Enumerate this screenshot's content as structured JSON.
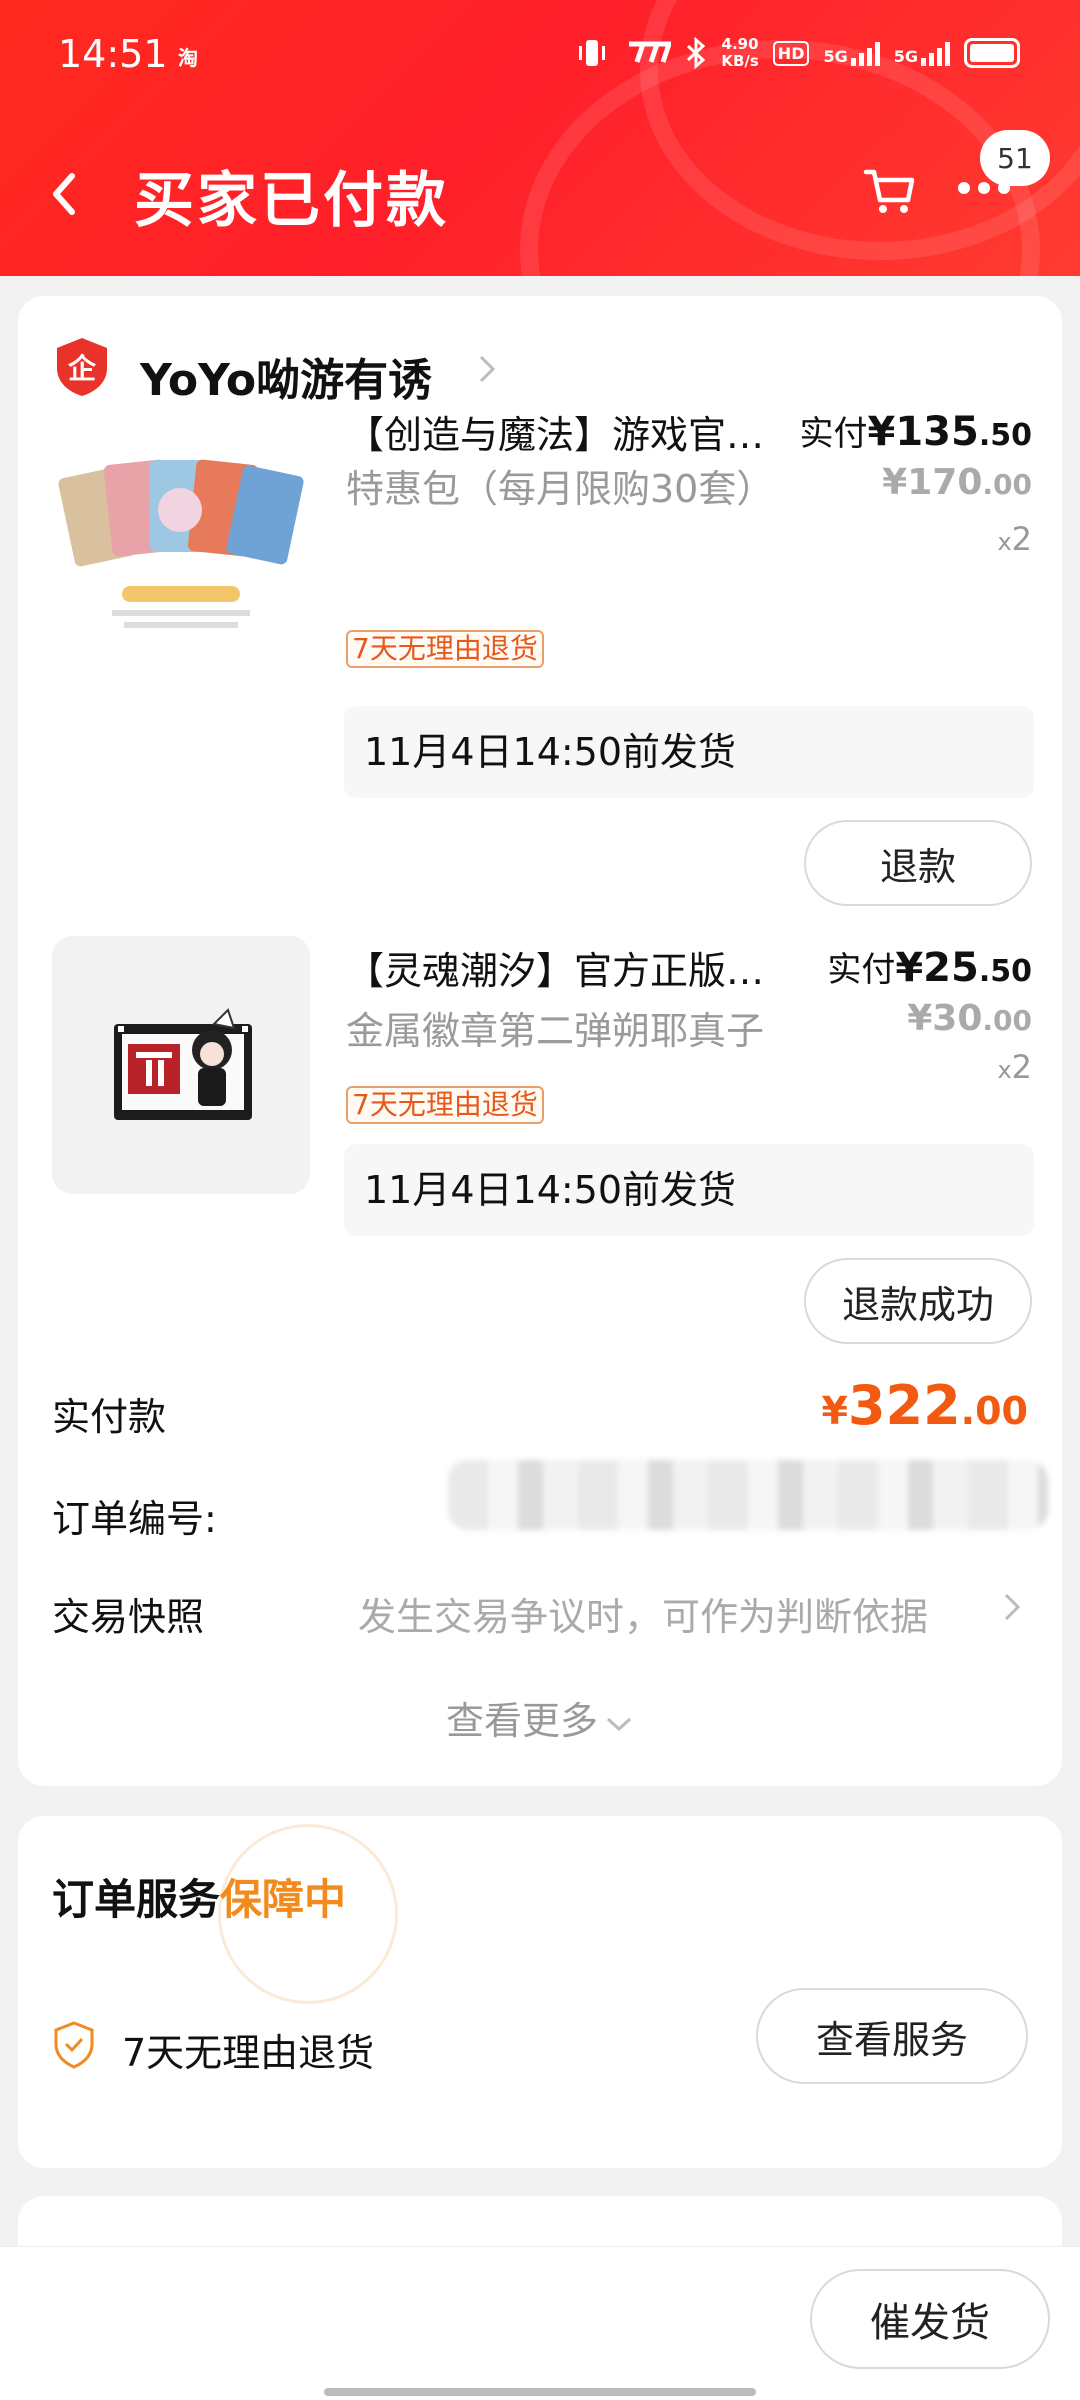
{
  "status_bar": {
    "time": "14:51",
    "app_indicator": "淘",
    "net_speed_value": "4.90",
    "net_speed_unit": "KB/s",
    "hd_label": "HD",
    "network_1": "5G",
    "network_2": "5G"
  },
  "nav": {
    "title": "买家已付款",
    "badge_count": "51",
    "back_icon": "chevron-left-icon",
    "cart_icon": "cart-icon",
    "more_icon": "more-dots-icon"
  },
  "shop": {
    "logo_text": "企",
    "name": "YoYo呦游有诱"
  },
  "products": [
    {
      "title": "【创造与魔法】游戏官…",
      "subtitle": "特惠包（每月限购30套）",
      "tag": "7天无理由退货",
      "paid_label": "实付",
      "paid_currency": "¥",
      "paid_int": "135",
      "paid_dec": ".50",
      "orig_currency": "¥",
      "orig_int": "170",
      "orig_dec": ".00",
      "qty_prefix": "x",
      "qty": "2",
      "ship": "11月4日14:50前发货",
      "action": "退款"
    },
    {
      "title": "【灵魂潮汐】官方正版…",
      "subtitle": "金属徽章第二弹朔耶真子",
      "tag": "7天无理由退货",
      "paid_label": "实付",
      "paid_currency": "¥",
      "paid_int": "25",
      "paid_dec": ".50",
      "orig_currency": "¥",
      "orig_int": "30",
      "orig_dec": ".00",
      "qty_prefix": "x",
      "qty": "2",
      "ship": "11月4日14:50前发货",
      "action": "退款成功"
    }
  ],
  "summary": {
    "paid_label": "实付款",
    "total_currency": "¥",
    "total_int": "322",
    "total_dec": ".00",
    "order_no_label": "订单编号:",
    "snapshot_label": "交易快照",
    "snapshot_text": "发生交易争议时，可作为判断依据",
    "more_label": "查看更多"
  },
  "service": {
    "title": "订单服务",
    "status": "保障中",
    "item": "7天无理由退货",
    "button": "查看服务"
  },
  "bottom": {
    "button": "催发货"
  },
  "colors": {
    "header_red": "#ff2a1e",
    "price_orange": "#f25a12",
    "guard_orange": "#f28a1e"
  }
}
